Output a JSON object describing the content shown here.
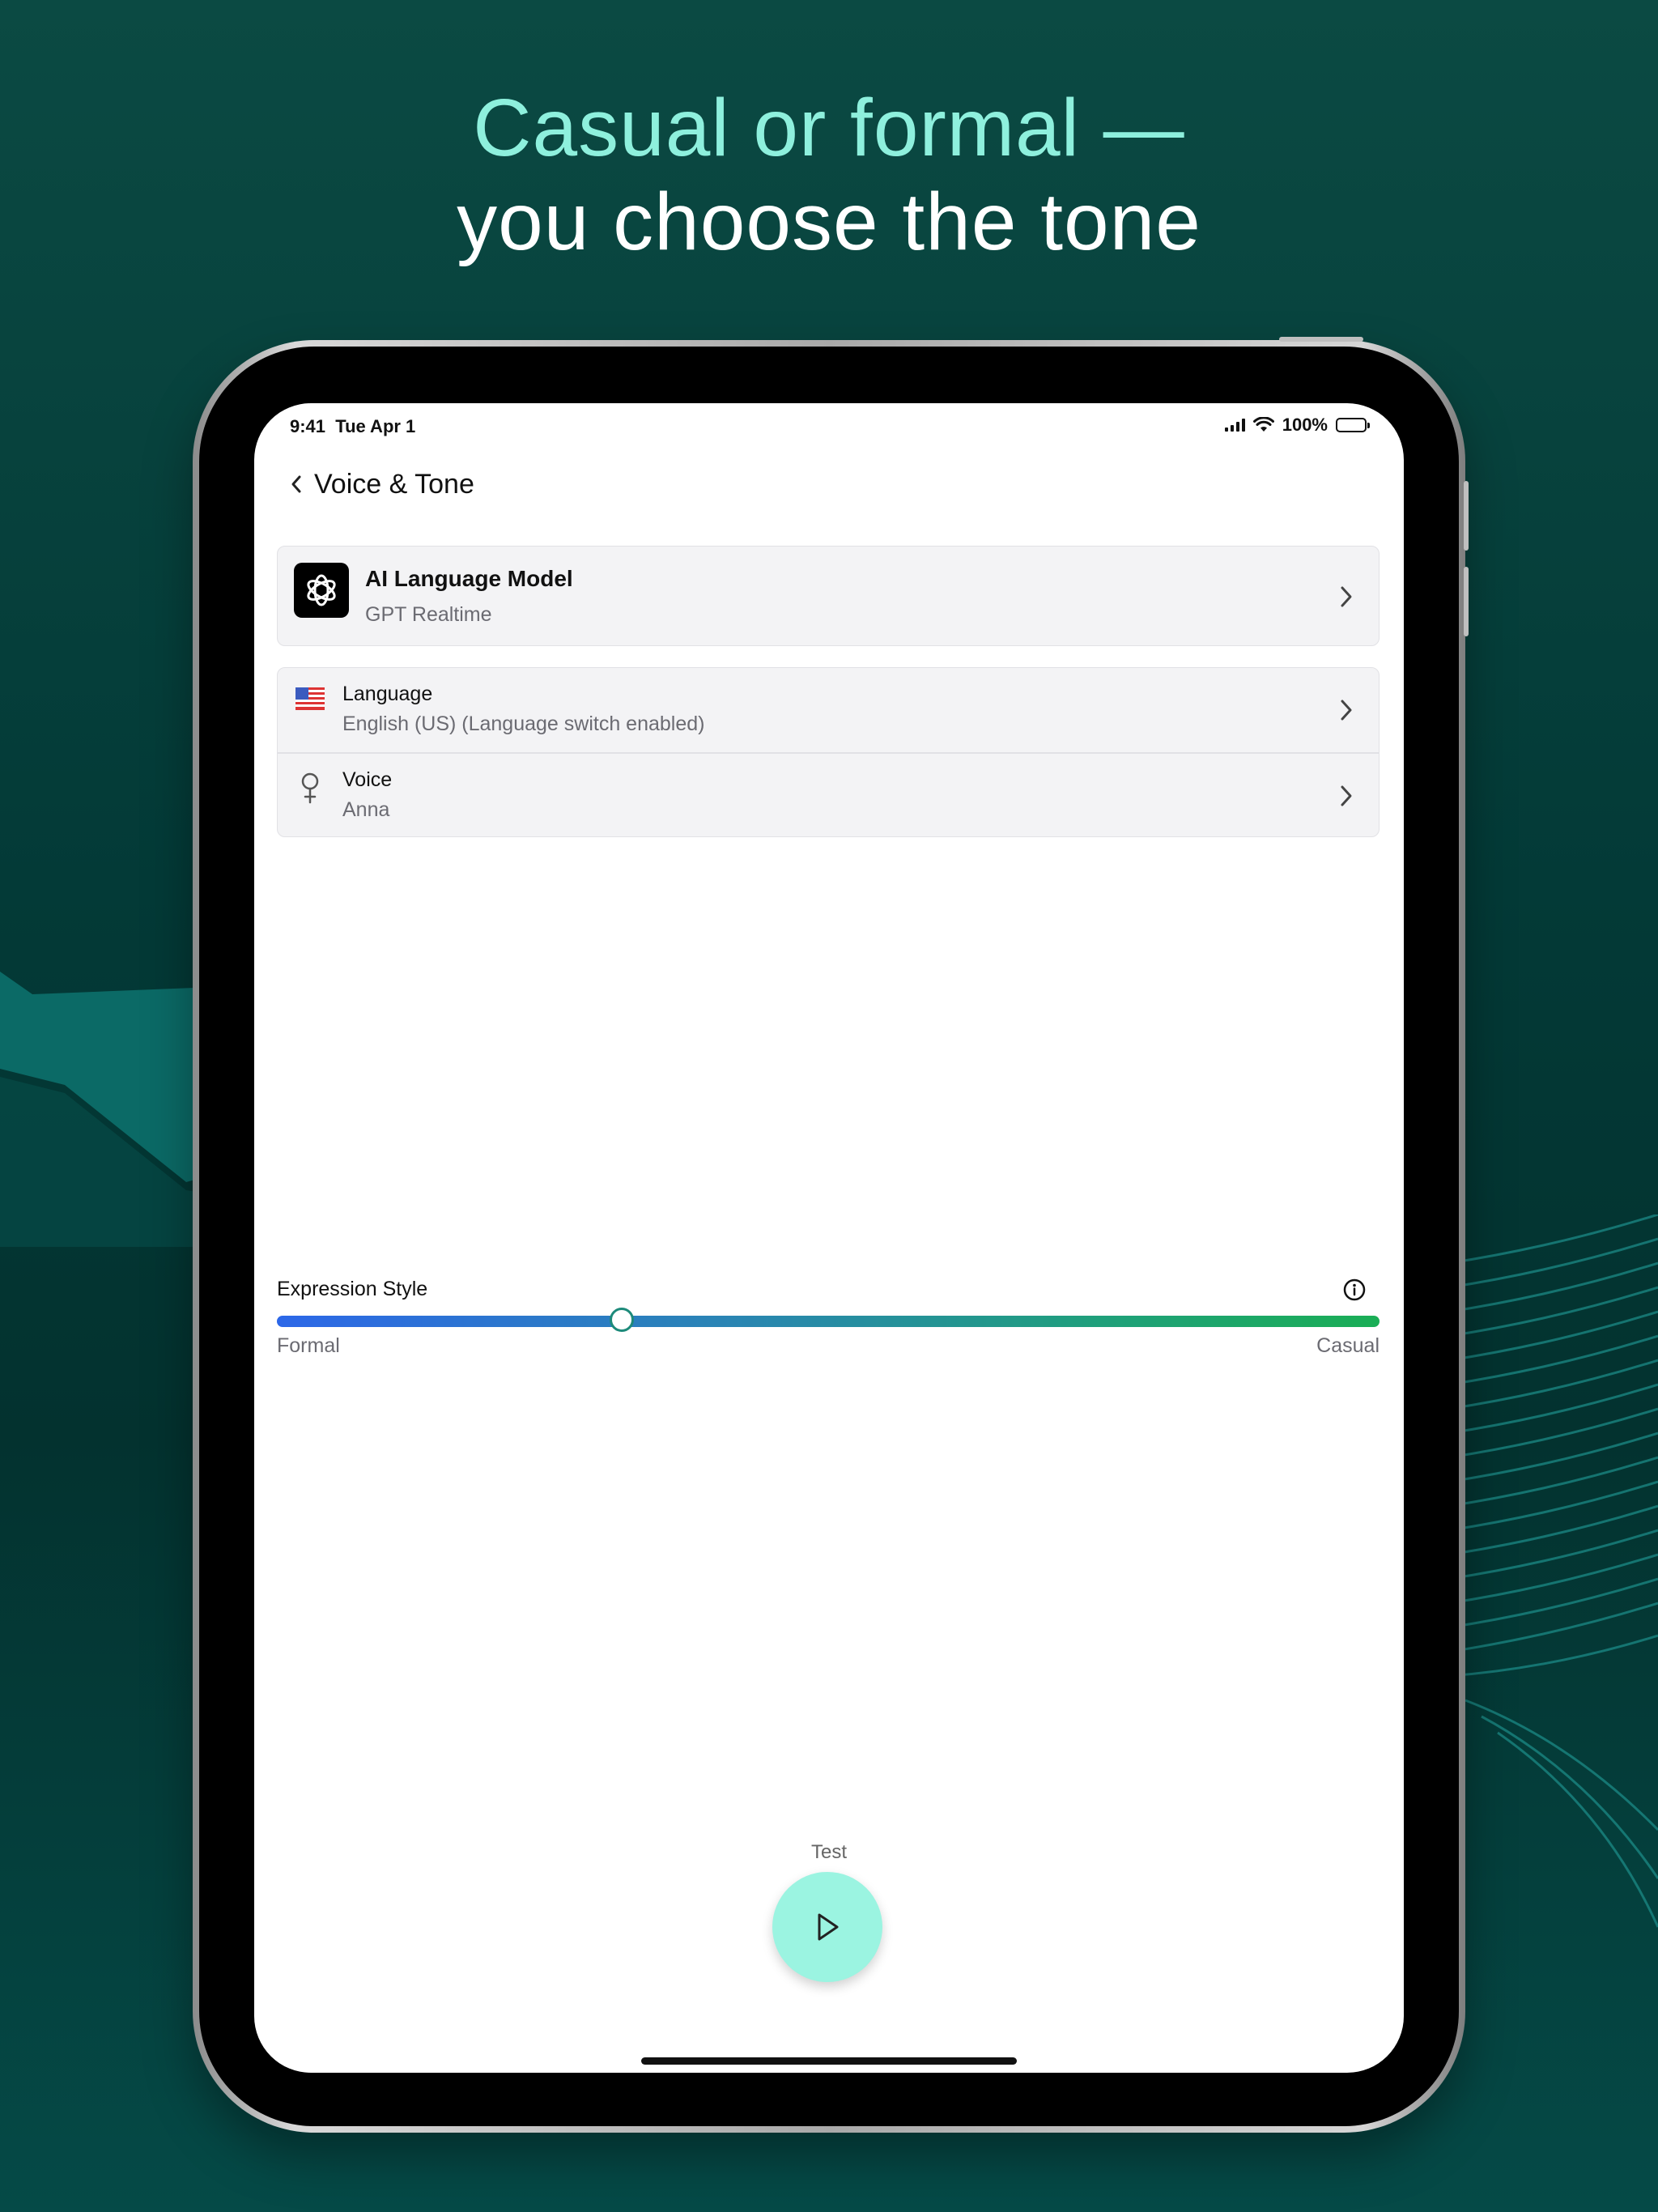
{
  "headline": {
    "line1": "Casual or formal —",
    "line2": "you choose the tone"
  },
  "status_bar": {
    "time": "9:41",
    "date": "Tue Apr 1",
    "battery": "100%"
  },
  "nav": {
    "title": "Voice & Tone",
    "back_icon": "chevron-left-icon"
  },
  "model_card": {
    "title": "AI Language Model",
    "subtitle": "GPT Realtime",
    "icon": "openai-logo-icon"
  },
  "settings": [
    {
      "title": "Language",
      "subtitle": "English (US) (Language switch enabled)",
      "icon": "us-flag-icon"
    },
    {
      "title": "Voice",
      "subtitle": "Anna",
      "icon": "female-symbol-icon"
    }
  ],
  "expression": {
    "label": "Expression Style",
    "min_label": "Formal",
    "max_label": "Casual",
    "value": 0.313
  },
  "test": {
    "label": "Test",
    "icon": "play-icon"
  },
  "colors": {
    "headline_accent": "#8ef0dd",
    "play_button": "#9bf4e1",
    "slider_start": "#2c67e8",
    "slider_end": "#1aae55"
  }
}
